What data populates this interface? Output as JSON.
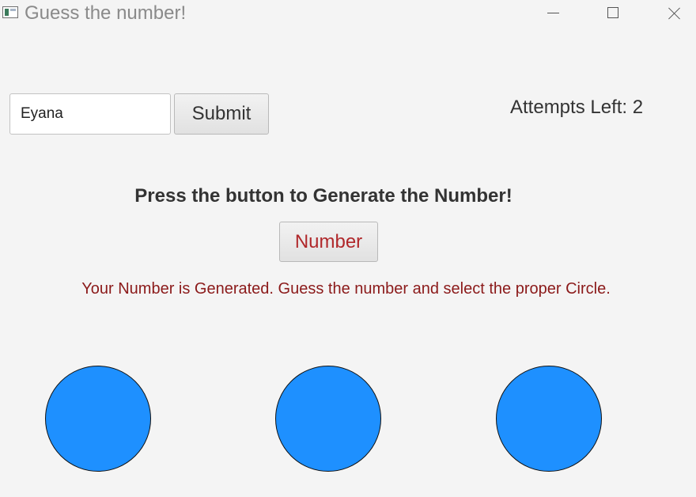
{
  "window": {
    "title": "Guess the number!"
  },
  "form": {
    "name_value": "Eyana",
    "submit_label": "Submit"
  },
  "status": {
    "attempts_text": "Attempts Left: 2",
    "message": "Your Number is Generated. Guess the number and select the proper Circle."
  },
  "generator": {
    "heading": "Press the button to Generate the Number!",
    "button_label": "Number"
  },
  "circles": {
    "count": 3,
    "fill_color": "#1e90ff"
  },
  "colors": {
    "number_button_text": "#b0282b",
    "status_message_text": "#8b1a1a"
  }
}
